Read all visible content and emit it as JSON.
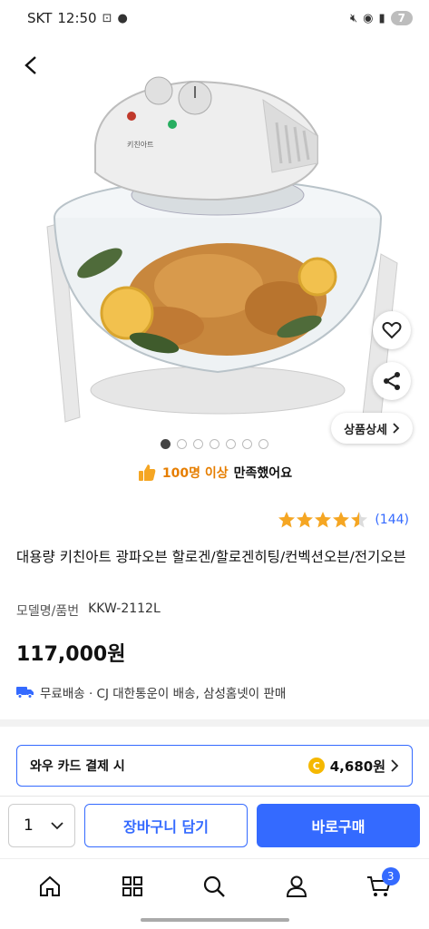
{
  "status_bar": {
    "carrier": "SKT",
    "time": "12:50",
    "battery": "7"
  },
  "hero": {
    "image_alt": "product photo: glass halogen convection oven with roasted chicken",
    "brand_text": "키친아트"
  },
  "product": {
    "detail_button": "상품상세",
    "carousel": {
      "total": 7,
      "active": 1
    },
    "satisfaction": {
      "highlight": "100명 이상",
      "rest": "만족했어요"
    },
    "rating": {
      "stars": 4.5,
      "count": "(144)"
    },
    "title": "대용량 키친아트 광파오븐 할로겐/할로겐히팅/컨벡션오븐/전기오븐",
    "model_label": "모델명/품번",
    "model_value": "KKW-2112L",
    "price": "117,000원",
    "delivery_text": "무료배송 · CJ 대한통운이 배송, 삼성홈넷이 판매"
  },
  "card_promo": {
    "label": "와우 카드 결제 시",
    "amount": "4,680원"
  },
  "buy_bar": {
    "qty": "1",
    "cart_label": "장바구니 담기",
    "buy_label": "바로구매"
  },
  "bottom_nav": {
    "cart_badge": "3"
  },
  "colors": {
    "accent": "#346aff",
    "star": "#f5a623",
    "coin": "#f5b800"
  }
}
